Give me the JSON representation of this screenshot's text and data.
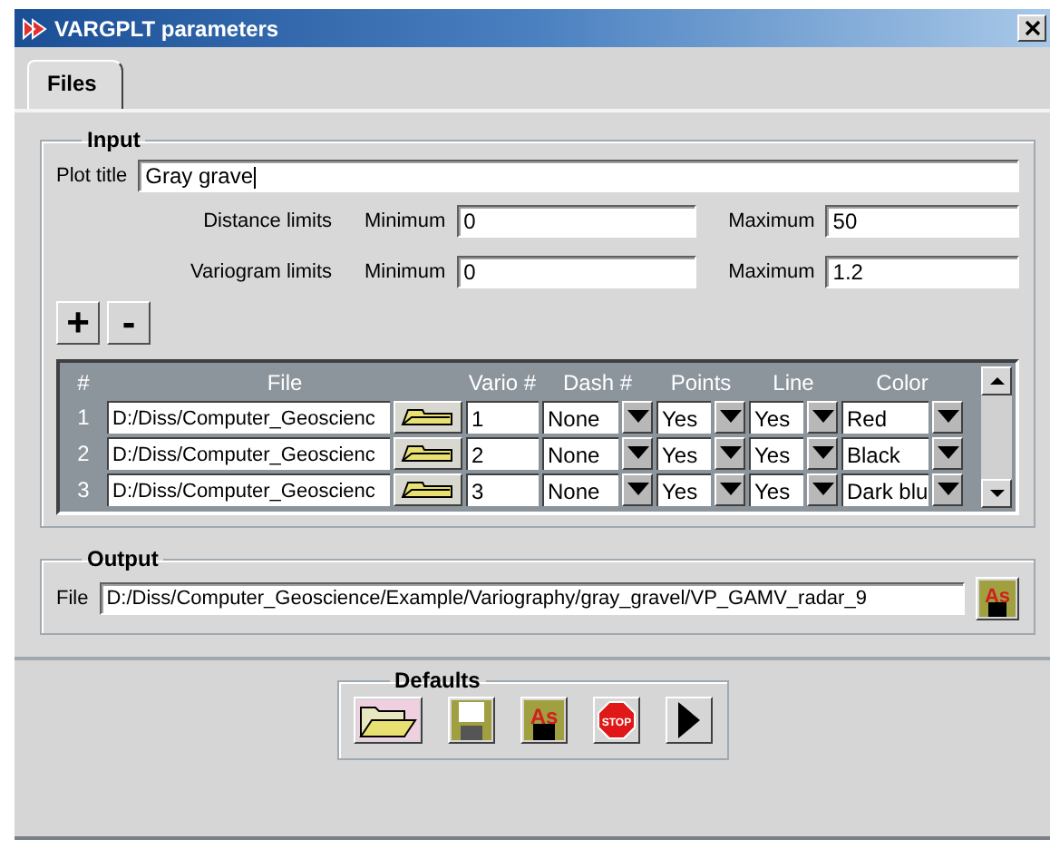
{
  "window": {
    "title": "VARGPLT parameters"
  },
  "tabs": [
    {
      "label": "Files",
      "selected": true
    }
  ],
  "input": {
    "legend": "Input",
    "plot_title": {
      "label": "Plot title",
      "value": "Gray grave"
    },
    "limits": [
      {
        "label": "Distance limits",
        "min_label": "Minimum",
        "min": "0",
        "max_label": "Maximum",
        "max": "50"
      },
      {
        "label": "Variogram limits",
        "min_label": "Minimum",
        "min": "0",
        "max_label": "Maximum",
        "max": "1.2"
      }
    ],
    "add_label": "+",
    "remove_label": "-",
    "table": {
      "columns": [
        "#",
        "File",
        "Vario #",
        "Dash #",
        "Points",
        "Line",
        "Color"
      ],
      "rows": [
        {
          "index": "1",
          "file": "D:/Diss/Computer_Geoscienc",
          "vario": "1",
          "dash": "None",
          "points": "Yes",
          "line": "Yes",
          "color_name": "Red"
        },
        {
          "index": "2",
          "file": "D:/Diss/Computer_Geoscienc",
          "vario": "2",
          "dash": "None",
          "points": "Yes",
          "line": "Yes",
          "color_name": "Black"
        },
        {
          "index": "3",
          "file": "D:/Diss/Computer_Geoscienc",
          "vario": "3",
          "dash": "None",
          "points": "Yes",
          "line": "Yes",
          "color_name": "Dark blu"
        }
      ]
    }
  },
  "output": {
    "legend": "Output",
    "label": "File",
    "value": "D:/Diss/Computer_Geoscience/Example/Variography/gray_gravel/VP_GAMV_radar_9",
    "save_as_label": "As"
  },
  "defaults": {
    "legend": "Defaults",
    "buttons": [
      {
        "kind": "open"
      },
      {
        "kind": "save"
      },
      {
        "kind": "save_as",
        "label": "As"
      },
      {
        "kind": "stop",
        "label": "STOP"
      },
      {
        "kind": "run"
      }
    ]
  }
}
